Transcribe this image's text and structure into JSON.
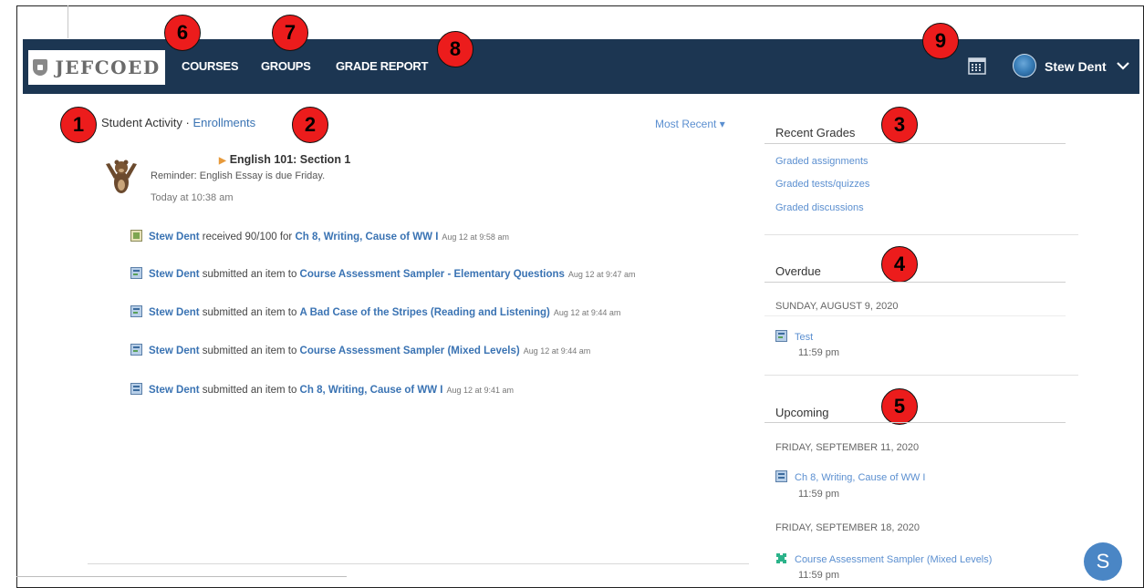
{
  "logo": {
    "text": "JEFCOED",
    "icon": "shield-icon"
  },
  "nav": {
    "courses": "COURSES",
    "groups": "GROUPS",
    "grade_report": "GRADE REPORT",
    "calendar_icon": "calendar-icon",
    "user_name": "Stew Dent",
    "menu_icon": "chevron-down-icon"
  },
  "callouts": [
    "1",
    "2",
    "3",
    "4",
    "5",
    "6",
    "7",
    "8",
    "9"
  ],
  "activity": {
    "title": "Student Activity",
    "separator": "·",
    "enrollments_link": "Enrollments",
    "sort": "Most Recent ▾",
    "post": {
      "course": "English 101: Section 1",
      "reminder": "Reminder:  English Essay is due Friday.",
      "time": "Today at 10:38 am"
    },
    "feed": [
      {
        "user": "Stew Dent",
        "action": " received 90/100 for ",
        "item": "Ch 8, Writing, Cause of WW I",
        "date": "Aug 12 at 9:58 am"
      },
      {
        "user": "Stew Dent",
        "action": " submitted an item to ",
        "item": "Course Assessment Sampler - Elementary Questions",
        "date": "Aug 12 at 9:47 am"
      },
      {
        "user": "Stew Dent",
        "action": " submitted an item to ",
        "item": "A Bad Case of the Stripes (Reading and Listening)",
        "date": "Aug 12 at 9:44 am"
      },
      {
        "user": "Stew Dent",
        "action": " submitted an item to ",
        "item": "Course Assessment Sampler (Mixed Levels)",
        "date": "Aug 12 at 9:44 am"
      },
      {
        "user": "Stew Dent",
        "action": " submitted an item to ",
        "item": "Ch 8, Writing, Cause of WW I",
        "date": "Aug 12 at 9:41 am"
      }
    ]
  },
  "recent_grades": {
    "title": "Recent Grades",
    "links": [
      "Graded assignments",
      "Graded tests/quizzes",
      "Graded discussions"
    ]
  },
  "overdue": {
    "title": "Overdue",
    "date": "SUNDAY, AUGUST 9, 2020",
    "item": "Test",
    "time": "11:59 pm"
  },
  "upcoming": {
    "title": "Upcoming",
    "groups": [
      {
        "date": "FRIDAY, SEPTEMBER 11, 2020",
        "item": "Ch 8, Writing, Cause of WW I",
        "time": "11:59 pm"
      },
      {
        "date": "FRIDAY, SEPTEMBER 18, 2020",
        "item": "Course Assessment Sampler (Mixed Levels)",
        "time": "11:59 pm"
      }
    ]
  },
  "chat": {
    "initial": "S"
  },
  "colors": {
    "navbar": "#1c3652",
    "link": "#3a73b3",
    "callout": "#ec1c1c"
  }
}
